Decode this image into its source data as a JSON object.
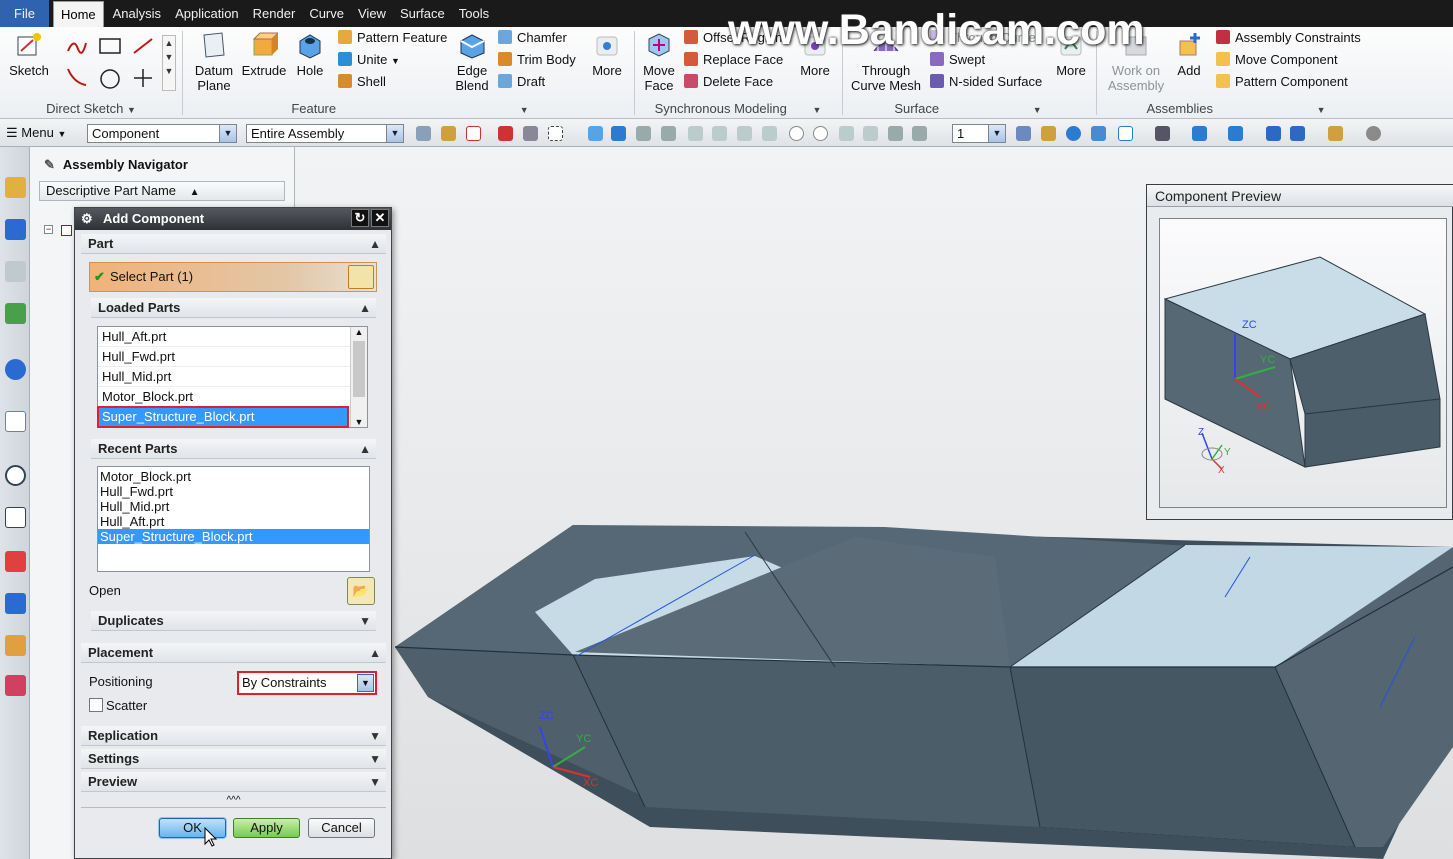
{
  "menubar": {
    "items": [
      "File",
      "Home",
      "Analysis",
      "Application",
      "Render",
      "Curve",
      "View",
      "Surface",
      "Tools"
    ]
  },
  "watermark": "www.Bandicam.com",
  "ribbon": {
    "direct_sketch": {
      "sketch": "Sketch",
      "group": "Direct Sketch"
    },
    "feature": {
      "datum_plane": "Datum Plane",
      "extrude": "Extrude",
      "hole": "Hole",
      "pattern_feature": "Pattern Feature",
      "unite": "Unite",
      "shell": "Shell",
      "edge_blend": "Edge Blend",
      "chamfer": "Chamfer",
      "trim_body": "Trim Body",
      "draft": "Draft",
      "more": "More",
      "group": "Feature"
    },
    "sync": {
      "move_face": "Move Face",
      "offset_region": "Offset Region",
      "replace_face": "Replace Face",
      "delete_face": "Delete Face",
      "more": "More",
      "group": "Synchronous Modeling"
    },
    "surface": {
      "through_curve_mesh": "Through Curve Mesh",
      "through_curves": "Through Curves",
      "swept": "Swept",
      "n_sided": "N-sided Surface",
      "more": "More",
      "group": "Surface"
    },
    "assemblies": {
      "work_on_assembly": "Work on Assembly",
      "add": "Add",
      "assembly_constraints": "Assembly Constraints",
      "move_component": "Move Component",
      "pattern_component": "Pattern Component",
      "group": "Assemblies"
    }
  },
  "toolbar": {
    "menu": "Menu",
    "filter": "Component",
    "scope": "Entire Assembly",
    "layer": "1"
  },
  "navigator": {
    "title": "Assembly Navigator",
    "column": "Descriptive Part Name"
  },
  "dialog": {
    "title": "Add Component",
    "part_section": "Part",
    "select_part": "Select Part (1)",
    "loaded_parts": {
      "title": "Loaded Parts",
      "items": [
        "Hull_Aft.prt",
        "Hull_Fwd.prt",
        "Hull_Mid.prt",
        "Motor_Block.prt",
        "Super_Structure_Block.prt"
      ],
      "selected": 4
    },
    "recent_parts": {
      "title": "Recent Parts",
      "items": [
        "Motor_Block.prt",
        "Hull_Fwd.prt",
        "Hull_Mid.prt",
        "Hull_Aft.prt",
        "Super_Structure_Block.prt"
      ],
      "selected": 4
    },
    "open": "Open",
    "duplicates": "Duplicates",
    "placement": "Placement",
    "positioning_label": "Positioning",
    "positioning_value": "By Constraints",
    "scatter": "Scatter",
    "scatter_checked": false,
    "replication": "Replication",
    "settings": "Settings",
    "preview": "Preview",
    "ok": "OK",
    "apply": "Apply",
    "cancel": "Cancel"
  },
  "component_preview": {
    "title": "Component Preview",
    "zc": "ZC",
    "xc": "XC",
    "yc": "YC",
    "z": "Z",
    "x": "X",
    "y": "Y"
  },
  "viewport": {
    "zc": "ZC",
    "yc": "YC",
    "xc": "XC"
  },
  "colors": {
    "accent": "#3399ff",
    "highlight_box": "#e0202a",
    "select_bar": "#f0b27a",
    "ok_button": "#7ec2f4",
    "apply_button": "#8fd46b"
  }
}
